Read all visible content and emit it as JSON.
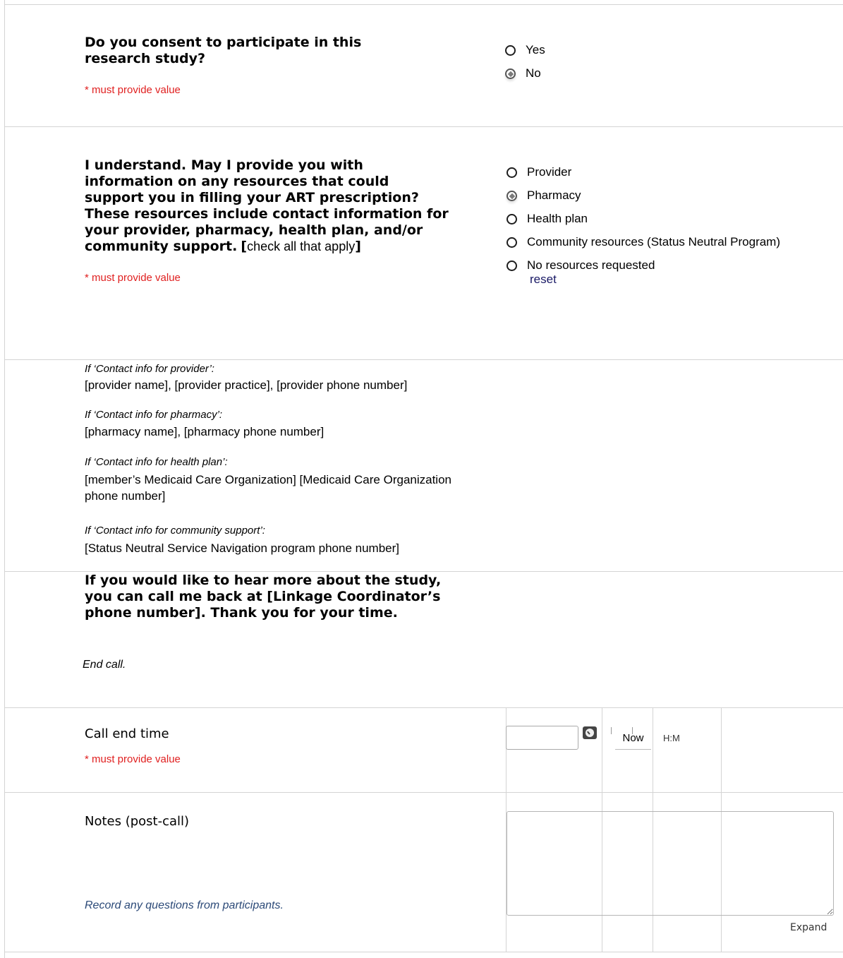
{
  "consent": {
    "question": "Do you consent to participate in this research study?",
    "required": "* must provide value",
    "options": [
      {
        "label": "Yes",
        "checked": false
      },
      {
        "label": "No",
        "checked": true
      }
    ]
  },
  "resources": {
    "question_bold": "I understand. May I provide you with information on any resources that could support you in filling your ART prescription? These resources include contact information for your provider, pharmacy, health plan, and/or community support.",
    "bracket_open": "[",
    "instruction": "check all that apply",
    "bracket_close": "]",
    "required": "* must provide value",
    "options": [
      {
        "label": "Provider",
        "checked": false
      },
      {
        "label": "Pharmacy",
        "checked": true
      },
      {
        "label": "Health plan",
        "checked": false
      },
      {
        "label": "Community resources (Status Neutral Program)",
        "checked": false
      },
      {
        "label": "No resources requested",
        "checked": false
      }
    ],
    "reset": "reset"
  },
  "info": {
    "provider_label": "If ‘Contact info for provider’:",
    "provider_text": "[provider name], [provider practice], [provider phone number]",
    "pharmacy_label": "If ‘Contact info for pharmacy’:",
    "pharmacy_text": "[pharmacy name], [pharmacy phone number]",
    "healthplan_label": "If ‘Contact info for health plan’:",
    "healthplan_text_1": "[member’s Medicaid Care Organization] [Medicaid Care Organization",
    "healthplan_text_2": "phone number]",
    "community_label": "If ‘Contact info for community support’:",
    "community_text": "[Status Neutral Service Navigation program phone number]"
  },
  "closing": {
    "text": "If you would like to hear more about the study, you can call me back at [Linkage Coordinator’s phone number]. Thank you for your time.",
    "end_call": "End call."
  },
  "call_end": {
    "label": "Call end time",
    "required": "* must provide value",
    "value": "",
    "now_button": "Now",
    "format": "H:M"
  },
  "notes": {
    "label": "Notes (post-call)",
    "hint": "Record any questions from participants.",
    "value": "",
    "expand": "Expand"
  }
}
